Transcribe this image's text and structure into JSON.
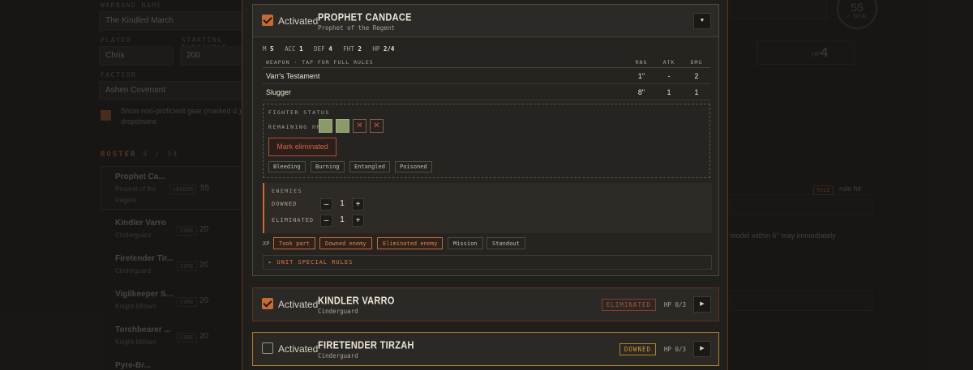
{
  "background": {
    "warband_label": "WARBAND NAME",
    "warband_name": "The Kindled March",
    "player_label": "PLAYER",
    "player_name": "Chris",
    "threshold_label": "STARTING THRESHOLD",
    "threshold_value": "200",
    "faction_label": "FACTION",
    "faction_value": "Ashen Covenant",
    "show_nonproficient": "Show non-proficient gear (marked d.)",
    "show_nonproficient_2": "dropdowns",
    "roster_label": "ROSTER",
    "roster_count": "4 / 34",
    "roster": [
      {
        "name": "Prophet Ca...",
        "sub": "Prophet of the",
        "sub2": "Regent",
        "tag": "LEADER",
        "pts": "55"
      },
      {
        "name": "Kindler Varro",
        "sub": "Cinderguard",
        "tag": "CORE",
        "pts": "20"
      },
      {
        "name": "Firetender Tir...",
        "sub": "Cinderguard",
        "tag": "CORE",
        "pts": "20"
      },
      {
        "name": "Vigilkeeper S...",
        "sub": "Knight-Militant",
        "tag": "CORE",
        "pts": "20"
      },
      {
        "name": "Torchbearer ...",
        "sub": "Knight-Militant",
        "tag": "CORE",
        "pts": "20"
      },
      {
        "name": "Pyre-Br..."
      }
    ],
    "total_value": "55",
    "total_label": "/ TOTAL",
    "hp_label": "HP",
    "hp_value": "4",
    "rule_tag": "RULE",
    "rule_label": "rule hit",
    "rule_text": "model within 6\" may immediately"
  },
  "fighters": [
    {
      "activated_label": "Activated",
      "name": "PROPHET CANDACE",
      "subtitle": "Prophet of the Regent",
      "toggle": "▼",
      "stats": [
        {
          "k": "M",
          "v": "5"
        },
        {
          "k": "ACC",
          "v": "1"
        },
        {
          "k": "DEF",
          "v": "4"
        },
        {
          "k": "FHT",
          "v": "2"
        },
        {
          "k": "HP",
          "v": "2/4"
        }
      ],
      "weapon_header": "WEAPON · TAP FOR FULL RULES",
      "col_rng": "RNG",
      "col_atk": "ATK",
      "col_dmg": "DMG",
      "weapons": [
        {
          "name": "Varr's Testament",
          "rng": "1\"",
          "atk": "-",
          "dmg": "2"
        },
        {
          "name": "Slugger",
          "rng": "8\"",
          "atk": "1",
          "dmg": "1"
        }
      ],
      "status_label": "FIGHTER STATUS",
      "remaining_hp_label": "REMAINING HP",
      "hp_lost_glyph": "✕",
      "mark_eliminated": "Mark eliminated",
      "conditions": [
        "Bleeding",
        "Burning",
        "Entangled",
        "Poisoned"
      ],
      "enemies_label": "ENEMIES",
      "downed_label": "DOWNED",
      "downed_value": "1",
      "eliminated_label": "ELIMINATED",
      "eliminated_value": "1",
      "minus": "–",
      "plus": "+",
      "xp_label": "XP",
      "xp_chips": [
        "Took part",
        "Downed enemy",
        "Eliminated enemy",
        "Mission",
        "Standout"
      ],
      "special_rules": "▸ UNIT SPECIAL RULES"
    },
    {
      "activated_label": "Activated",
      "name": "KINDLER VARRO",
      "subtitle": "Cinderguard",
      "badge": "ELIMINATED",
      "hp": "HP 0/3",
      "toggle": "▶"
    },
    {
      "activated_label": "Activated",
      "name": "FIRETENDER TIRZAH",
      "subtitle": "Cinderguard",
      "badge": "DOWNED",
      "hp": "HP 0/3",
      "toggle": "▶"
    }
  ]
}
